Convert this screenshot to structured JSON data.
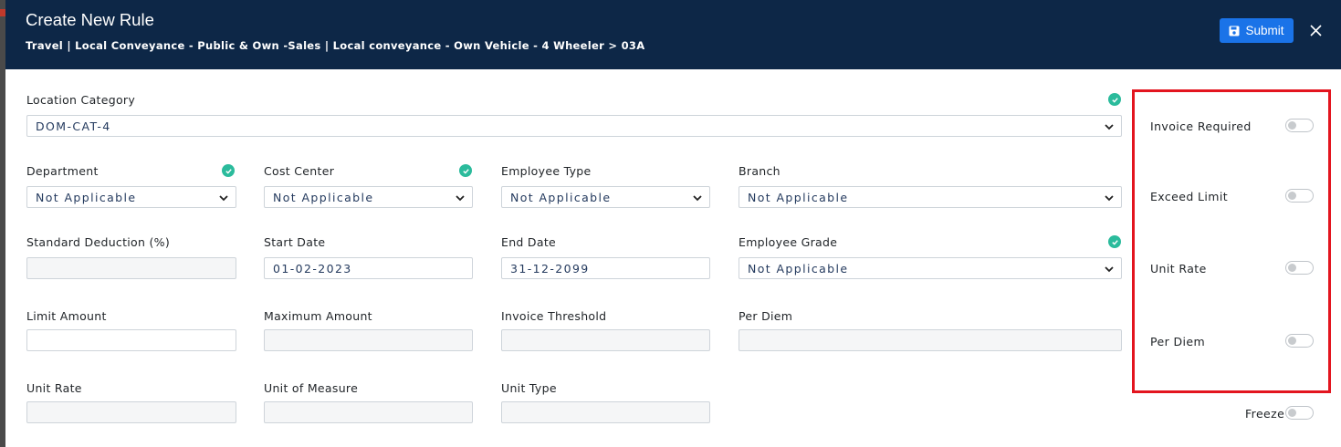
{
  "header": {
    "title": "Create New Rule",
    "subtitle": "Travel | Local Conveyance - Public & Own -Sales | Local conveyance - Own Vehicle - 4 Wheeler > 03A",
    "submit_label": "Submit"
  },
  "fields": {
    "location_category": {
      "label": "Location Category",
      "value": "DOM-CAT-4"
    },
    "department": {
      "label": "Department",
      "value": "Not Applicable"
    },
    "cost_center": {
      "label": "Cost Center",
      "value": "Not Applicable"
    },
    "employee_type": {
      "label": "Employee Type",
      "value": "Not Applicable"
    },
    "branch": {
      "label": "Branch",
      "value": "Not Applicable"
    },
    "standard_deduction": {
      "label": "Standard Deduction (%)",
      "value": ""
    },
    "start_date": {
      "label": "Start Date",
      "value": "01-02-2023"
    },
    "end_date": {
      "label": "End Date",
      "value": "31-12-2099"
    },
    "employee_grade": {
      "label": "Employee Grade",
      "value": "Not Applicable"
    },
    "limit_amount": {
      "label": "Limit Amount",
      "value": ""
    },
    "maximum_amount": {
      "label": "Maximum Amount",
      "value": ""
    },
    "invoice_threshold": {
      "label": "Invoice Threshold",
      "value": ""
    },
    "per_diem": {
      "label": "Per Diem",
      "value": ""
    },
    "unit_rate": {
      "label": "Unit Rate",
      "value": ""
    },
    "unit_of_measure": {
      "label": "Unit of Measure",
      "value": ""
    },
    "unit_type": {
      "label": "Unit Type",
      "value": ""
    }
  },
  "toggles": {
    "invoice_required": {
      "label": "Invoice Required",
      "on": false
    },
    "exceed_limit": {
      "label": "Exceed Limit",
      "on": false
    },
    "unit_rate": {
      "label": "Unit Rate",
      "on": false
    },
    "per_diem": {
      "label": "Per Diem",
      "on": false
    },
    "freeze": {
      "label": "Freeze",
      "on": false
    }
  },
  "colors": {
    "header_bg": "#0d2747",
    "submit_bg": "#1a73e8",
    "check_green": "#2bbb9c",
    "highlight_red": "#e3151f"
  }
}
